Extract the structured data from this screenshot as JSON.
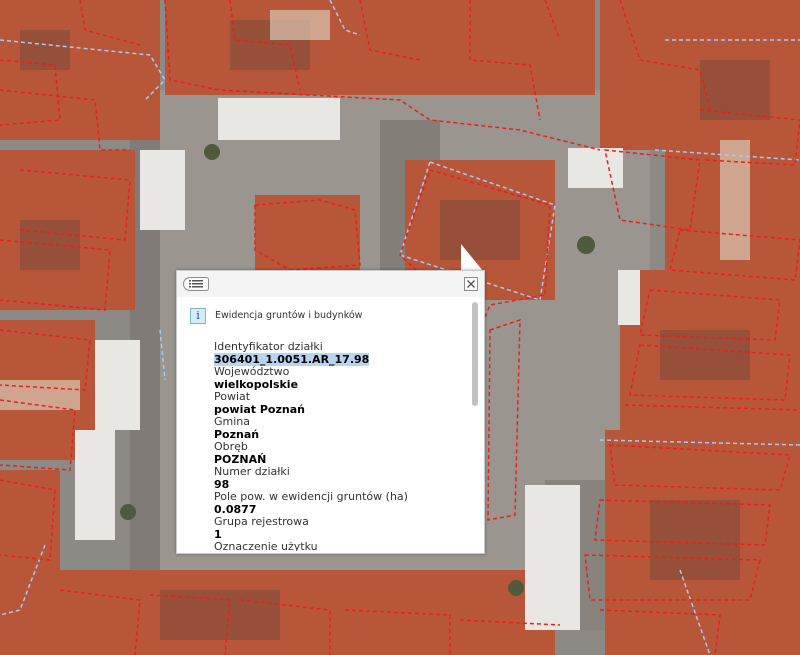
{
  "map": {
    "parcel_line_color": "#e8201a",
    "building_line_color": "#a9c9f5",
    "roof_color": "#b8563a",
    "square_color": "#8d8a86"
  },
  "popup": {
    "list_icon": "list-icon",
    "close_icon": "close-icon",
    "info_icon": "info-icon",
    "info_glyph": "i",
    "layer_title": "Ewidencja gruntów i budynków",
    "attributes": [
      {
        "label": "Identyfikator działki",
        "value": "306401_1.0051.AR_17.98",
        "highlighted": true
      },
      {
        "label": "Województwo",
        "value": "wielkopolskie"
      },
      {
        "label": "Powiat",
        "value": "powiat Poznań"
      },
      {
        "label": "Gmina",
        "value": "Poznań"
      },
      {
        "label": "Obręb",
        "value": "POZNAŃ"
      },
      {
        "label": "Numer działki",
        "value": "98"
      },
      {
        "label": "Pole pow. w ewidencji gruntów (ha)",
        "value": "0.0877"
      },
      {
        "label": "Grupa rejestrowa",
        "value": "1"
      },
      {
        "label": "Oznaczenie użytku",
        "value": ""
      }
    ],
    "scroll_fraction": 0.0
  }
}
